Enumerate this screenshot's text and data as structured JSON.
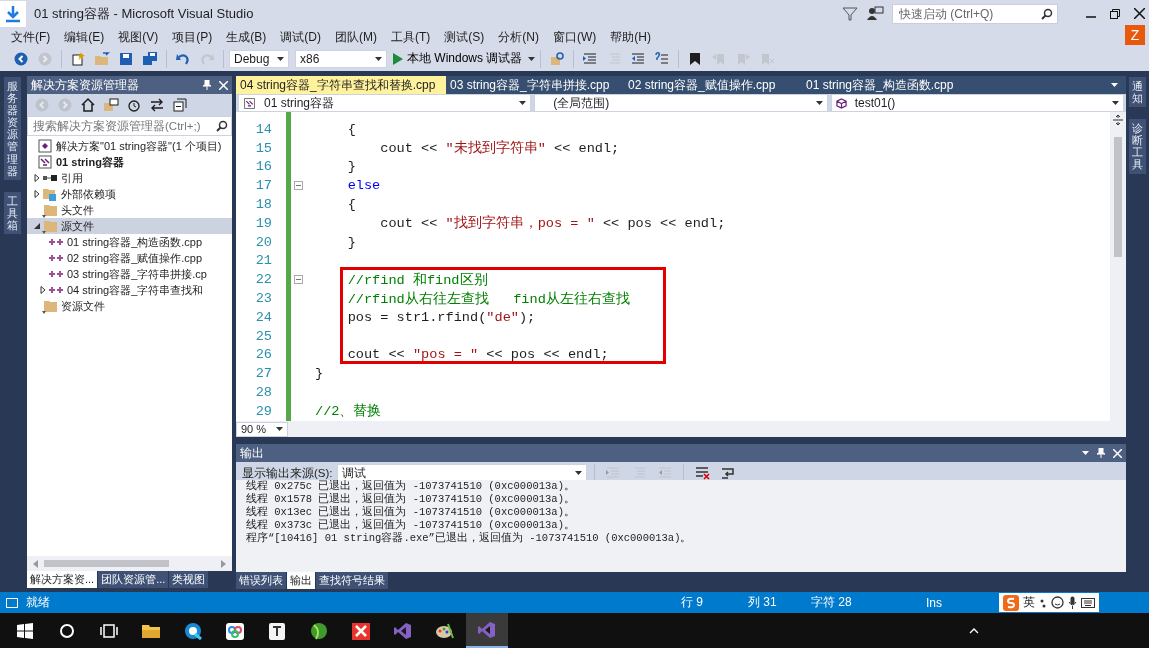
{
  "window": {
    "title": "01 string容器 - Microsoft Visual Studio",
    "quick_launch": {
      "placeholder": "快速启动 (Ctrl+Q)"
    },
    "account": "Z"
  },
  "menu": [
    "文件(F)",
    "编辑(E)",
    "视图(V)",
    "项目(P)",
    "生成(B)",
    "调试(D)",
    "团队(M)",
    "工具(T)",
    "测试(S)",
    "分析(N)",
    "窗口(W)",
    "帮助(H)"
  ],
  "toolbar": {
    "left": [
      {
        "kind": "back",
        "disabled": false
      },
      {
        "kind": "forward",
        "disabled": true
      },
      {
        "kind": "new",
        "disabled": false
      },
      {
        "kind": "open",
        "disabled": false
      },
      {
        "kind": "save",
        "disabled": false
      },
      {
        "kind": "saveall",
        "disabled": false
      },
      {
        "kind": "undo",
        "disabled": false
      },
      {
        "kind": "redo",
        "disabled": true
      }
    ],
    "configuration": "Debug",
    "platform": "x86",
    "run": "本地 Windows 调试器",
    "right": [
      {
        "kind": "find",
        "disabled": false
      },
      {
        "kind": "outdent",
        "disabled": false
      },
      {
        "kind": "comment",
        "disabled": true
      },
      {
        "kind": "indent",
        "disabled": false
      },
      {
        "kind": "uncomment",
        "disabled": false
      },
      {
        "kind": "bookmark",
        "disabled": false
      },
      {
        "kind": "prevmark",
        "disabled": true
      },
      {
        "kind": "nextmark",
        "disabled": true
      },
      {
        "kind": "clearmark",
        "disabled": true
      }
    ]
  },
  "left_dock": [
    "服务器资源管理器",
    "工具箱"
  ],
  "right_dock": [
    "通知",
    "诊断工具"
  ],
  "solution_explorer": {
    "title": "解决方案资源管理器",
    "toolbar": [
      {
        "kind": "back",
        "disabled": true
      },
      {
        "kind": "forward",
        "disabled": true
      },
      {
        "kind": "home",
        "disabled": false
      },
      {
        "kind": "switch",
        "disabled": false
      },
      {
        "kind": "history",
        "disabled": false
      },
      {
        "kind": "sync",
        "disabled": false
      },
      {
        "kind": "collapse",
        "disabled": false
      }
    ],
    "search": {
      "placeholder": "搜索解决方案资源管理器(Ctrl+;)"
    },
    "tree": [
      {
        "label": "解决方案\"01 string容器\"(1 个项目)",
        "kind": "solution",
        "selected": false,
        "children": [
          {
            "label": "01 string容器",
            "kind": "project",
            "selected": false,
            "children": [
              {
                "label": "引用",
                "kind": "references",
                "expanded": false,
                "selected": false
              },
              {
                "label": "外部依赖项",
                "kind": "external",
                "expanded": false,
                "selected": false
              },
              {
                "label": "头文件",
                "kind": "folder",
                "selected": false
              },
              {
                "label": "源文件",
                "kind": "folder",
                "expanded": true,
                "selected": true,
                "children": [
                  {
                    "label": "01 string容器_构造函数.cpp",
                    "kind": "cpp",
                    "selected": false
                  },
                  {
                    "label": "02 string容器_赋值操作.cpp",
                    "kind": "cpp",
                    "selected": false
                  },
                  {
                    "label": "03 string容器_字符串拼接.cp",
                    "kind": "cpp",
                    "selected": false
                  },
                  {
                    "label": "04 string容器_字符串查找和",
                    "kind": "cpp",
                    "expanded": false,
                    "selected": false
                  }
                ]
              },
              {
                "label": "资源文件",
                "kind": "folder",
                "selected": false
              }
            ]
          }
        ]
      }
    ],
    "tabs": [
      {
        "label": "解决方案资...",
        "selected": true
      },
      {
        "label": "团队资源管...",
        "selected": false
      },
      {
        "label": "类视图",
        "selected": false
      }
    ]
  },
  "editor": {
    "tabs": [
      {
        "label": "04 string容器_字符串查找和替换.cpp",
        "selected": true
      },
      {
        "label": "03 string容器_字符串拼接.cpp",
        "selected": false
      },
      {
        "label": "02 string容器_赋值操作.cpp",
        "selected": false
      },
      {
        "label": "01 string容器_构造函数.cpp",
        "selected": false
      }
    ],
    "nav": [
      "01 string容器",
      "(全局范围)",
      "test01()"
    ],
    "lines": [
      {
        "number": "14",
        "fold": false,
        "highlighted": false,
        "tokens": [
          {
            "kind": "plain",
            "text": "    {"
          }
        ]
      },
      {
        "number": "15",
        "fold": false,
        "highlighted": false,
        "tokens": [
          {
            "kind": "plain",
            "text": "        cout << "
          },
          {
            "kind": "string",
            "text": "\"未找到字符串\""
          },
          {
            "kind": "plain",
            "text": " << endl;"
          }
        ]
      },
      {
        "number": "16",
        "fold": false,
        "highlighted": false,
        "tokens": [
          {
            "kind": "plain",
            "text": "    }"
          }
        ]
      },
      {
        "number": "17",
        "fold": true,
        "highlighted": false,
        "tokens": [
          {
            "kind": "keyword",
            "text": "    else"
          }
        ]
      },
      {
        "number": "18",
        "fold": false,
        "highlighted": false,
        "tokens": [
          {
            "kind": "plain",
            "text": "    {"
          }
        ]
      },
      {
        "number": "19",
        "fold": false,
        "highlighted": false,
        "tokens": [
          {
            "kind": "plain",
            "text": "        cout << "
          },
          {
            "kind": "string",
            "text": "\"找到字符串，pos = \""
          },
          {
            "kind": "plain",
            "text": " << pos << endl;"
          }
        ]
      },
      {
        "number": "20",
        "fold": false,
        "highlighted": false,
        "tokens": [
          {
            "kind": "plain",
            "text": "    }"
          }
        ]
      },
      {
        "number": "21",
        "fold": false,
        "highlighted": false
      },
      {
        "number": "22",
        "fold": true,
        "highlighted": true,
        "tokens": [
          {
            "kind": "comment",
            "text": "    //rfind 和find区别"
          }
        ]
      },
      {
        "number": "23",
        "fold": false,
        "highlighted": true,
        "tokens": [
          {
            "kind": "comment",
            "text": "    //rfind从右往左查找   find从左往右查找"
          }
        ]
      },
      {
        "number": "24",
        "fold": false,
        "highlighted": true,
        "tokens": [
          {
            "kind": "plain",
            "text": "    pos = str1.rfind("
          },
          {
            "kind": "string",
            "text": "\"de\""
          },
          {
            "kind": "plain",
            "text": ");"
          }
        ]
      },
      {
        "number": "25",
        "fold": false,
        "highlighted": true
      },
      {
        "number": "26",
        "fold": false,
        "highlighted": true,
        "tokens": [
          {
            "kind": "plain",
            "text": "    cout << "
          },
          {
            "kind": "string",
            "text": "\"pos = \""
          },
          {
            "kind": "plain",
            "text": " << pos << endl;"
          }
        ]
      },
      {
        "number": "27",
        "fold": false,
        "highlighted": false,
        "tokens": [
          {
            "kind": "plain",
            "text": "}"
          }
        ]
      },
      {
        "number": "28",
        "fold": false,
        "highlighted": false
      },
      {
        "number": "29",
        "fold": false,
        "highlighted": false,
        "tokens": [
          {
            "kind": "comment",
            "text": "//2、替换"
          }
        ]
      }
    ],
    "zoom": "90 %"
  },
  "output": {
    "title": "输出",
    "source_label": "显示输出来源(S):",
    "source": "调试",
    "lines": [
      "线程 0x275c 已退出，返回值为 -1073741510 (0xc000013a)。",
      "线程 0x1578 已退出，返回值为 -1073741510 (0xc000013a)。",
      "线程 0x13ec 已退出，返回值为 -1073741510 (0xc000013a)。",
      "线程 0x373c 已退出，返回值为 -1073741510 (0xc000013a)。",
      "程序“[10416] 01 string容器.exe”已退出，返回值为 -1073741510 (0xc000013a)。"
    ],
    "tabs": [
      {
        "label": "错误列表",
        "selected": false
      },
      {
        "label": "输出",
        "selected": true
      },
      {
        "label": "查找符号结果",
        "selected": false
      }
    ]
  },
  "status_bar": {
    "message": "就绪",
    "line": "行 9",
    "column": "列 31",
    "char": "字符 28",
    "mode": "Ins",
    "ime": "英"
  },
  "taskbar": [
    {
      "kind": "start",
      "selected": false
    },
    {
      "kind": "search",
      "selected": false
    },
    {
      "kind": "taskview",
      "selected": false
    },
    {
      "kind": "folder",
      "selected": false
    },
    {
      "kind": "browser",
      "selected": false
    },
    {
      "kind": "cloud",
      "selected": false
    },
    {
      "kind": "notes",
      "selected": false
    },
    {
      "kind": "ball",
      "selected": false
    },
    {
      "kind": "xmind",
      "selected": false
    },
    {
      "kind": "vs",
      "selected": false
    },
    {
      "kind": "paint",
      "selected": false
    },
    {
      "kind": "vs",
      "selected": true
    }
  ]
}
